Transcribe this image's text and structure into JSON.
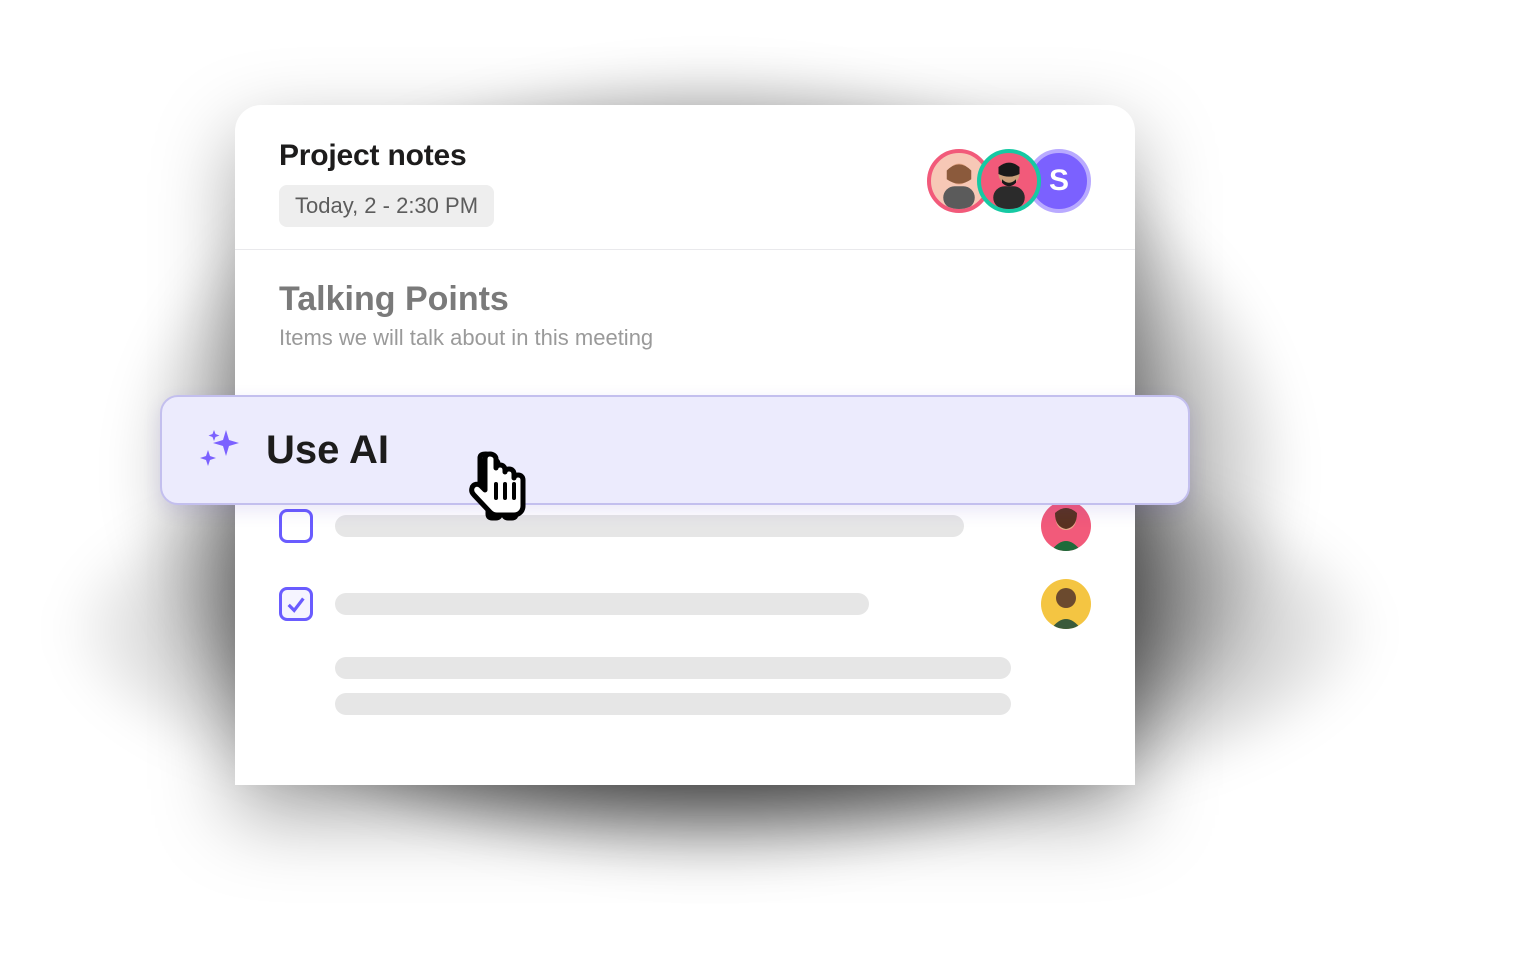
{
  "header": {
    "title": "Project notes",
    "time": "Today, 2 - 2:30 PM"
  },
  "participants": [
    {
      "kind": "photo",
      "ring": "#f25a7a",
      "bg": "#f7c8b6"
    },
    {
      "kind": "photo",
      "ring": "#16c9a3",
      "bg": "#f25a7a"
    },
    {
      "kind": "initial",
      "ring": "#8e79ff",
      "bg": "#7b61ff",
      "initial": "S"
    }
  ],
  "section": {
    "title": "Talking Points",
    "subtitle": "Items we will talk about in this meeting"
  },
  "ai_bar": {
    "label": "Use AI"
  },
  "items": [
    {
      "checked": false,
      "assignee_bg": "#f25a7a"
    },
    {
      "checked": true,
      "assignee_bg": "#f4c542"
    }
  ]
}
